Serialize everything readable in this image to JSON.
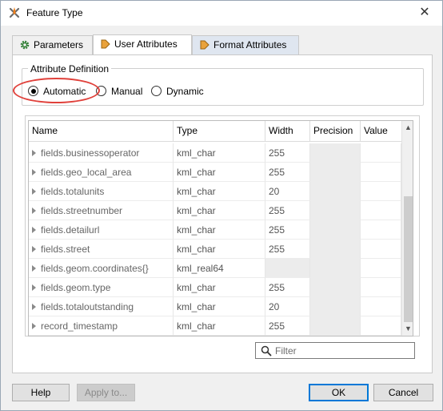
{
  "window": {
    "title": "Feature Type",
    "close_glyph": "✕"
  },
  "tabs": [
    {
      "label": "Parameters",
      "icon": "gear-icon"
    },
    {
      "label": "User Attributes",
      "icon": "arrow-icon",
      "active": true
    },
    {
      "label": "Format Attributes",
      "icon": "arrow-icon"
    }
  ],
  "attribute_definition": {
    "title": "Attribute Definition",
    "options": [
      {
        "label": "Automatic",
        "checked": true
      },
      {
        "label": "Manual",
        "checked": false
      },
      {
        "label": "Dynamic",
        "checked": false
      }
    ]
  },
  "table": {
    "headers": [
      "Name",
      "Type",
      "Width",
      "Precision",
      "Value"
    ],
    "rows": [
      {
        "name": "fields.businessoperator",
        "type": "kml_char",
        "width": "255"
      },
      {
        "name": "fields.geo_local_area",
        "type": "kml_char",
        "width": "255"
      },
      {
        "name": "fields.totalunits",
        "type": "kml_char",
        "width": "20"
      },
      {
        "name": "fields.streetnumber",
        "type": "kml_char",
        "width": "255"
      },
      {
        "name": "fields.detailurl",
        "type": "kml_char",
        "width": "255"
      },
      {
        "name": "fields.street",
        "type": "kml_char",
        "width": "255"
      },
      {
        "name": "fields.geom.coordinates{}",
        "type": "kml_real64",
        "width": ""
      },
      {
        "name": "fields.geom.type",
        "type": "kml_char",
        "width": "255"
      },
      {
        "name": "fields.totaloutstanding",
        "type": "kml_char",
        "width": "20"
      },
      {
        "name": "record_timestamp",
        "type": "kml_char",
        "width": "255"
      }
    ]
  },
  "filter": {
    "placeholder": "Filter",
    "value": ""
  },
  "buttons": {
    "help": "Help",
    "apply": "Apply to...",
    "ok": "OK",
    "cancel": "Cancel"
  },
  "colors": {
    "highlight": "#e0413b",
    "default_button_border": "#0078d7"
  }
}
